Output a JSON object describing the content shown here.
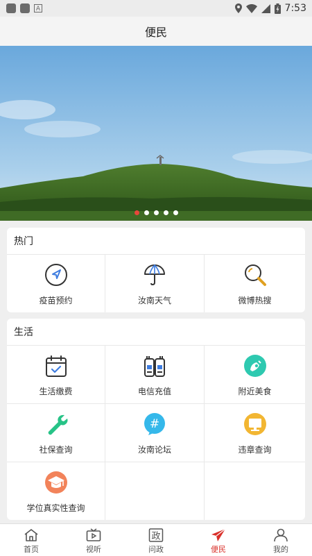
{
  "status_bar": {
    "time": "7:53"
  },
  "header": {
    "title": "便民"
  },
  "banner": {
    "dot_count": 5,
    "active_dot": 0
  },
  "hot_section": {
    "title": "热门",
    "items": [
      {
        "label": "疫苗预约",
        "icon": "navigation-arrow-icon"
      },
      {
        "label": "汝南天气",
        "icon": "umbrella-icon"
      },
      {
        "label": "微博热搜",
        "icon": "magnifier-icon"
      }
    ]
  },
  "life_section": {
    "title": "生活",
    "items": [
      {
        "label": "生活缴费",
        "icon": "calendar-check-icon"
      },
      {
        "label": "电信充值",
        "icon": "phone-recharge-icon"
      },
      {
        "label": "附近美食",
        "icon": "food-icon"
      },
      {
        "label": "社保查询",
        "icon": "wrench-icon"
      },
      {
        "label": "汝南论坛",
        "icon": "hashtag-bubble-icon"
      },
      {
        "label": "违章查询",
        "icon": "monitor-icon"
      },
      {
        "label": "学位真实性查询",
        "icon": "graduation-cap-icon"
      }
    ]
  },
  "tabs": [
    {
      "label": "首页",
      "icon": "home-icon"
    },
    {
      "label": "视听",
      "icon": "tv-play-icon"
    },
    {
      "label": "问政",
      "icon": "zheng-char-icon",
      "glyph": "政"
    },
    {
      "label": "便民",
      "icon": "paper-plane-icon",
      "active": true
    },
    {
      "label": "我的",
      "icon": "user-icon"
    }
  ],
  "colors": {
    "accent": "#d9302a",
    "food": "#2ec9b0",
    "forum": "#35b8ea",
    "traffic": "#f2b632",
    "degree": "#f2835a",
    "social": "#27c387"
  }
}
